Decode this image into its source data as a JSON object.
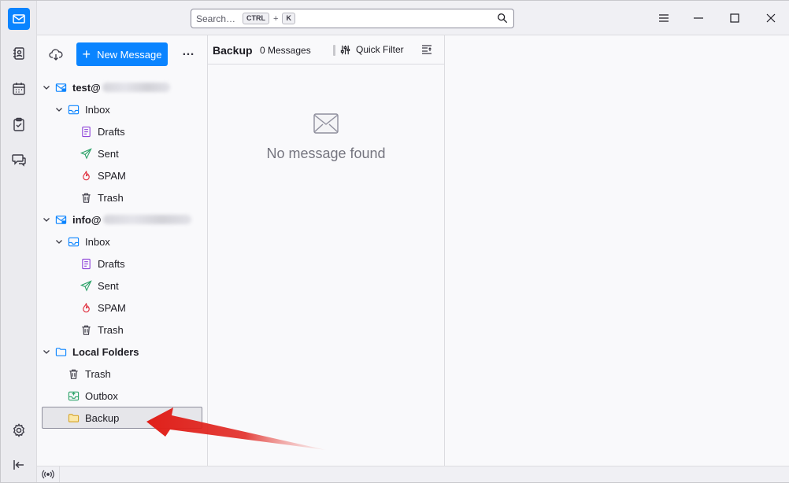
{
  "titlebar": {
    "search_placeholder": "Search…",
    "shortcut_key1": "CTRL",
    "shortcut_plus": "+",
    "shortcut_key2": "K"
  },
  "folder_pane": {
    "new_message_label": "New Message",
    "more_label": "…"
  },
  "accounts": [
    {
      "name": "test@",
      "folders": [
        "Inbox",
        "Drafts",
        "Sent",
        "SPAM",
        "Trash"
      ]
    },
    {
      "name": "info@",
      "folders": [
        "Inbox",
        "Drafts",
        "Sent",
        "SPAM",
        "Trash"
      ]
    }
  ],
  "local_folders": {
    "name": "Local Folders",
    "folders": [
      "Trash",
      "Outbox",
      "Backup"
    ]
  },
  "thread_pane": {
    "folder_name": "Backup",
    "message_count": "0 Messages",
    "quick_filter_label": "Quick Filter",
    "empty_message": "No message found"
  },
  "colors": {
    "accent": "#0a84ff",
    "drafts_icon": "#8f46d9",
    "sent_icon": "#2ea36a",
    "spam_icon": "#e02e3d",
    "folder_icon": "#f0c040",
    "annotation_arrow": "#e0201a"
  }
}
